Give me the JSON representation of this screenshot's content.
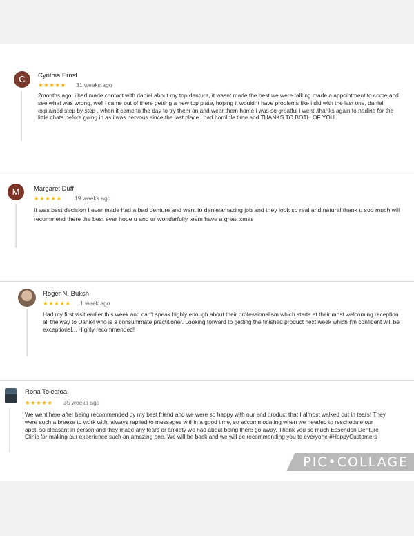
{
  "colors": {
    "star": "#f5b301",
    "avatar_c": "#7a3b2e",
    "avatar_m": "#7b3326"
  },
  "reviews": [
    {
      "initial": "C",
      "name": "Cynthia Ernst",
      "stars": "★★★★★",
      "time": "31 weeks ago",
      "text": "2months ago, i had made contact with daniel about my top denture, it wasnt made the best we were talking made a appointment to come and see what was wrong, well i came out of there getting a new top plate, hoping it wouldnt have problems like i did with the last one, daniel explained step by step , when it came to the day to try them on and wear them home i was so greatful i went ,thanks again to nadine for the little chats before going in as i was nervous since the last place i had horrilble time and THANKS TO BOTH OF YOU"
    },
    {
      "initial": "M",
      "name": "Margaret Duff",
      "stars": "★★★★★",
      "time": "19 weeks ago",
      "text": "It was best decision I ever made had a bad denture and went to danielamazing job and they look so real and natural thank u soo much will recommend there the best ever hope u and ur wonderfully team have a great xmas"
    },
    {
      "initial": "",
      "name": "Roger N. Buksh",
      "stars": "★★★★★",
      "time": "1 week ago",
      "text": "Had my first visit earlier this week and can't speak highly enough about their professionalism which starts at their most welcoming reception all the way to Daniel who is a consummate practitioner. Looking forward to getting the finished product next week which I'm confident will be exceptional... Highly recommended!"
    },
    {
      "initial": "",
      "name": "Rona Toleafoa",
      "stars": "★★★★★",
      "time": "35 weeks ago",
      "text": "We went here after being recommended by my best friend and we were so happy with our end product that I almost walked out in tears! They were such a breeze to work with, always replied to messages within a good time, so accommodating when we needed to reschedule our appt, so pleasant in person and they made any fears or anxiety we had about being there go away. Thank you so much Essendon Denture Clinic for making our experience such an amazing one. We will be back and we will be recommending you to everyone #HappyCustomers"
    }
  ],
  "watermark": "PIC•COLLAGE"
}
